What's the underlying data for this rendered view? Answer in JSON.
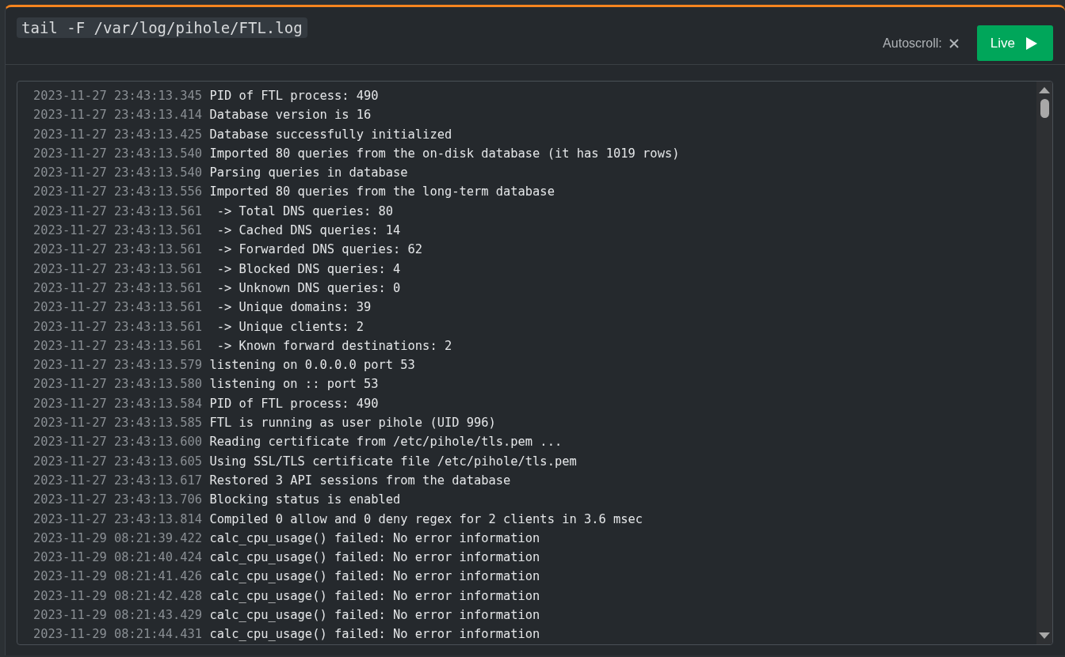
{
  "command": "tail -F /var/log/pihole/FTL.log",
  "autoscroll": {
    "label": "Autoscroll:",
    "enabled": false
  },
  "live_button": {
    "label": "Live"
  },
  "log_lines": [
    {
      "time": "2023-11-27 23:43:13.345",
      "message": "PID of FTL process: 490"
    },
    {
      "time": "2023-11-27 23:43:13.414",
      "message": "Database version is 16"
    },
    {
      "time": "2023-11-27 23:43:13.425",
      "message": "Database successfully initialized"
    },
    {
      "time": "2023-11-27 23:43:13.540",
      "message": "Imported 80 queries from the on-disk database (it has 1019 rows)"
    },
    {
      "time": "2023-11-27 23:43:13.540",
      "message": "Parsing queries in database"
    },
    {
      "time": "2023-11-27 23:43:13.556",
      "message": "Imported 80 queries from the long-term database"
    },
    {
      "time": "2023-11-27 23:43:13.561",
      "message": " -> Total DNS queries: 80"
    },
    {
      "time": "2023-11-27 23:43:13.561",
      "message": " -> Cached DNS queries: 14"
    },
    {
      "time": "2023-11-27 23:43:13.561",
      "message": " -> Forwarded DNS queries: 62"
    },
    {
      "time": "2023-11-27 23:43:13.561",
      "message": " -> Blocked DNS queries: 4"
    },
    {
      "time": "2023-11-27 23:43:13.561",
      "message": " -> Unknown DNS queries: 0"
    },
    {
      "time": "2023-11-27 23:43:13.561",
      "message": " -> Unique domains: 39"
    },
    {
      "time": "2023-11-27 23:43:13.561",
      "message": " -> Unique clients: 2"
    },
    {
      "time": "2023-11-27 23:43:13.561",
      "message": " -> Known forward destinations: 2"
    },
    {
      "time": "2023-11-27 23:43:13.579",
      "message": "listening on 0.0.0.0 port 53"
    },
    {
      "time": "2023-11-27 23:43:13.580",
      "message": "listening on :: port 53"
    },
    {
      "time": "2023-11-27 23:43:13.584",
      "message": "PID of FTL process: 490"
    },
    {
      "time": "2023-11-27 23:43:13.585",
      "message": "FTL is running as user pihole (UID 996)"
    },
    {
      "time": "2023-11-27 23:43:13.600",
      "message": "Reading certificate from /etc/pihole/tls.pem ..."
    },
    {
      "time": "2023-11-27 23:43:13.605",
      "message": "Using SSL/TLS certificate file /etc/pihole/tls.pem"
    },
    {
      "time": "2023-11-27 23:43:13.617",
      "message": "Restored 3 API sessions from the database"
    },
    {
      "time": "2023-11-27 23:43:13.706",
      "message": "Blocking status is enabled"
    },
    {
      "time": "2023-11-27 23:43:13.814",
      "message": "Compiled 0 allow and 0 deny regex for 2 clients in 3.6 msec"
    },
    {
      "time": "2023-11-29 08:21:39.422",
      "message": "calc_cpu_usage() failed: No error information"
    },
    {
      "time": "2023-11-29 08:21:40.424",
      "message": "calc_cpu_usage() failed: No error information"
    },
    {
      "time": "2023-11-29 08:21:41.426",
      "message": "calc_cpu_usage() failed: No error information"
    },
    {
      "time": "2023-11-29 08:21:42.428",
      "message": "calc_cpu_usage() failed: No error information"
    },
    {
      "time": "2023-11-29 08:21:43.429",
      "message": "calc_cpu_usage() failed: No error information"
    },
    {
      "time": "2023-11-29 08:21:44.431",
      "message": "calc_cpu_usage() failed: No error information"
    }
  ]
}
